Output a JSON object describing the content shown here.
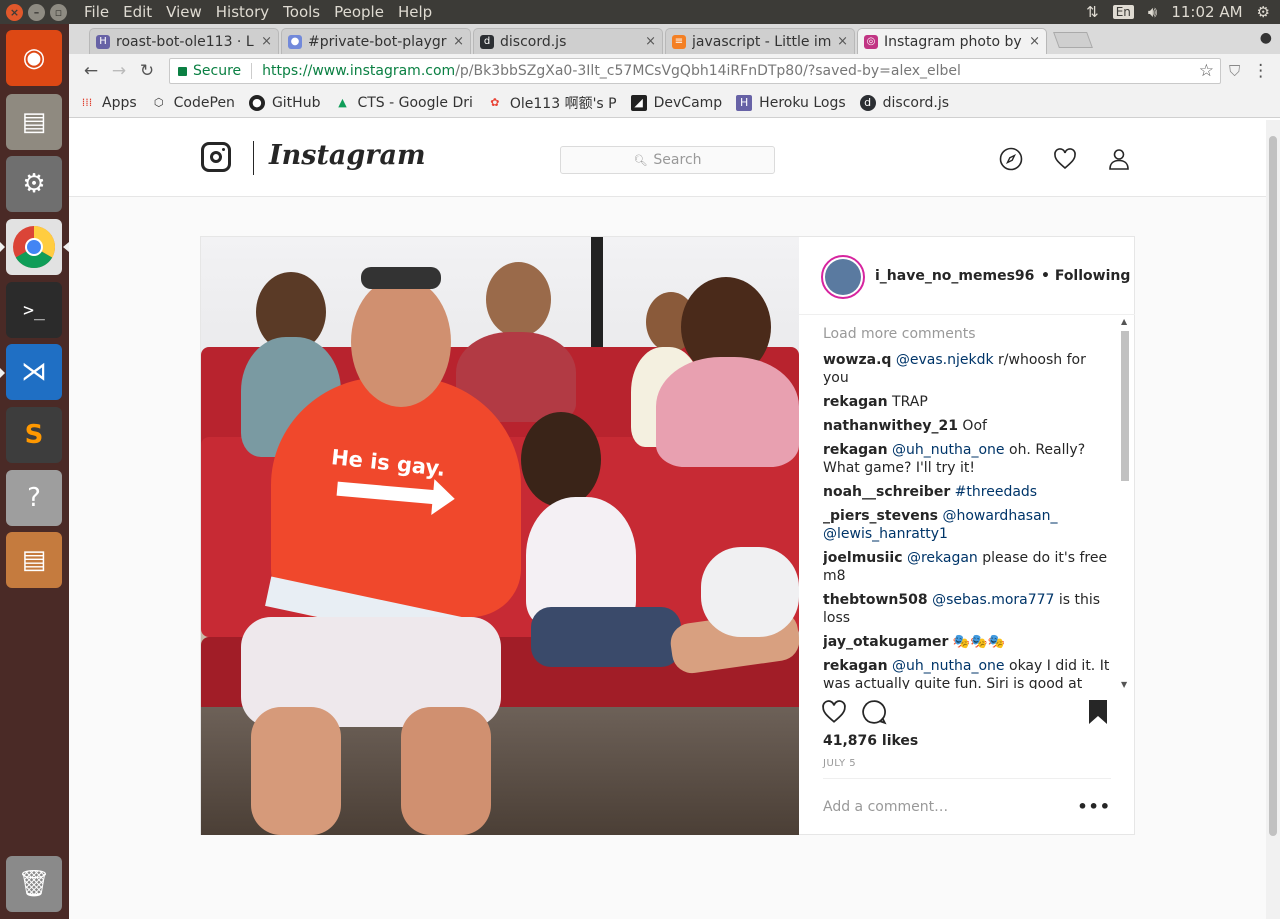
{
  "os": {
    "menus": [
      "File",
      "Edit",
      "View",
      "History",
      "Tools",
      "People",
      "Help"
    ],
    "keyboard_layout": "En",
    "clock": "11:02 AM"
  },
  "browser": {
    "tabs": [
      {
        "title": "roast-bot-ole113 · L",
        "icon": "heroku-icon",
        "color": "#6762a6"
      },
      {
        "title": "#private-bot-playgr",
        "icon": "discord-icon",
        "color": "#7289da"
      },
      {
        "title": "discord.js",
        "icon": "discordjs-icon",
        "color": "#2c2f33"
      },
      {
        "title": "javascript - Little im",
        "icon": "stackoverflow-icon",
        "color": "#f48024"
      },
      {
        "title": "Instagram photo by",
        "icon": "instagram-icon",
        "color": "#c13584"
      }
    ],
    "secure_label": "Secure",
    "url_host": "https://www.instagram.com",
    "url_path": "/p/Bk3bbSZgXa0-3Ilt_c57MCsVgQbh14iRFnDTp80/?saved-by=alex_elbel",
    "bookmarks": [
      "Apps",
      "CodePen",
      "GitHub",
      "CTS - Google Dri",
      "Ole113 啊额's P",
      "DevCamp",
      "Heroku Logs",
      "discord.js"
    ]
  },
  "instagram": {
    "wordmark": "Instagram",
    "search_placeholder": "Search",
    "post": {
      "shirt_text": "He is gay.",
      "username": "i_have_no_memes96...",
      "following": "• Following",
      "load_more": "Load more comments",
      "comments": [
        {
          "user": "wowza.q",
          "mention": "@evas.njekdk",
          "text": " r/whoosh for you"
        },
        {
          "user": "rekagan",
          "mention": "",
          "text": " TRAP"
        },
        {
          "user": "nathanwithey_21",
          "mention": "",
          "text": " Oof"
        },
        {
          "user": "rekagan",
          "mention": "@uh_nutha_one",
          "text": " oh. Really? What game? I'll try it!"
        },
        {
          "user": "noah__schreiber",
          "mention": "#threedads",
          "text": ""
        },
        {
          "user": "_piers_stevens",
          "mention": "@howardhasan_ @lewis_hanratty1",
          "text": ""
        },
        {
          "user": "joelmusiic",
          "mention": "@rekagan",
          "text": " please do it's free m8"
        },
        {
          "user": "thebtown508",
          "mention": "@sebas.mora777",
          "text": " is this loss"
        },
        {
          "user": "jay_otakugamer",
          "mention": "",
          "text": " 🎭🎭🎭"
        },
        {
          "user": "rekagan",
          "mention": "@uh_nutha_one",
          "text": " okay I did it. It was actually quite fun. Siri is good at checkers"
        }
      ],
      "likes": "41,876 likes",
      "date": "JULY 5",
      "add_comment_placeholder": "Add a comment…",
      "more_options": "•••"
    }
  }
}
